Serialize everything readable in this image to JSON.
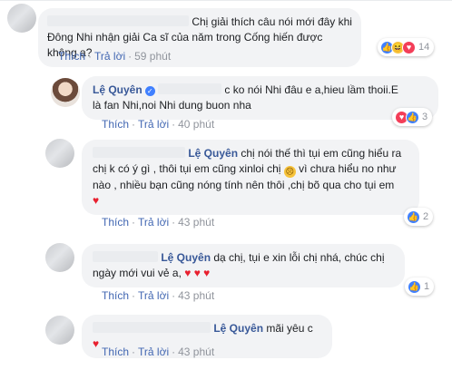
{
  "action_like": "Thích",
  "action_reply": "Trả lời",
  "comments": [
    {
      "text": "Chị giải thích câu nói mới đây khi Đông Nhi nhận giải Ca sĩ của năm trong Cống hiến được không ạ?",
      "time": "59 phút",
      "reaction_count": "14"
    },
    {
      "name": "Lệ Quyên",
      "text_line1": "c ko nói Nhi đâu e a,hieu lầm thoii.E",
      "text_line2": "là fan Nhi,noi Nhi dung buon nha",
      "time": "40 phút",
      "reaction_count": "3"
    },
    {
      "tag": "Lệ Quyên",
      "text_line1": "chị nói thế thì tụi em cũng hiểu ra",
      "text_line2a": "chị k có ý gì , thôi tụi em cũng xinloi chị",
      "text_line2b": "vì chưa hiểu no như",
      "text_line3": "nào , nhiều bạn cũng nóng tính nên thôi ,chị bõ qua cho tụi em",
      "heart": "♥",
      "time": "43 phút",
      "reaction_count": "2"
    },
    {
      "tag": "Lệ Quyên",
      "text_line1": "dạ chị, tụi e xin lỗi chị nhá, chúc chị",
      "text_line2": "ngày mới vui vẻ a,",
      "hearts": "♥ ♥ ♥",
      "time": "43 phút",
      "reaction_count": "1"
    },
    {
      "tag": "Lệ Quyên",
      "text": "mãi yêu c",
      "heart": "♥",
      "time": "43 phút"
    }
  ]
}
